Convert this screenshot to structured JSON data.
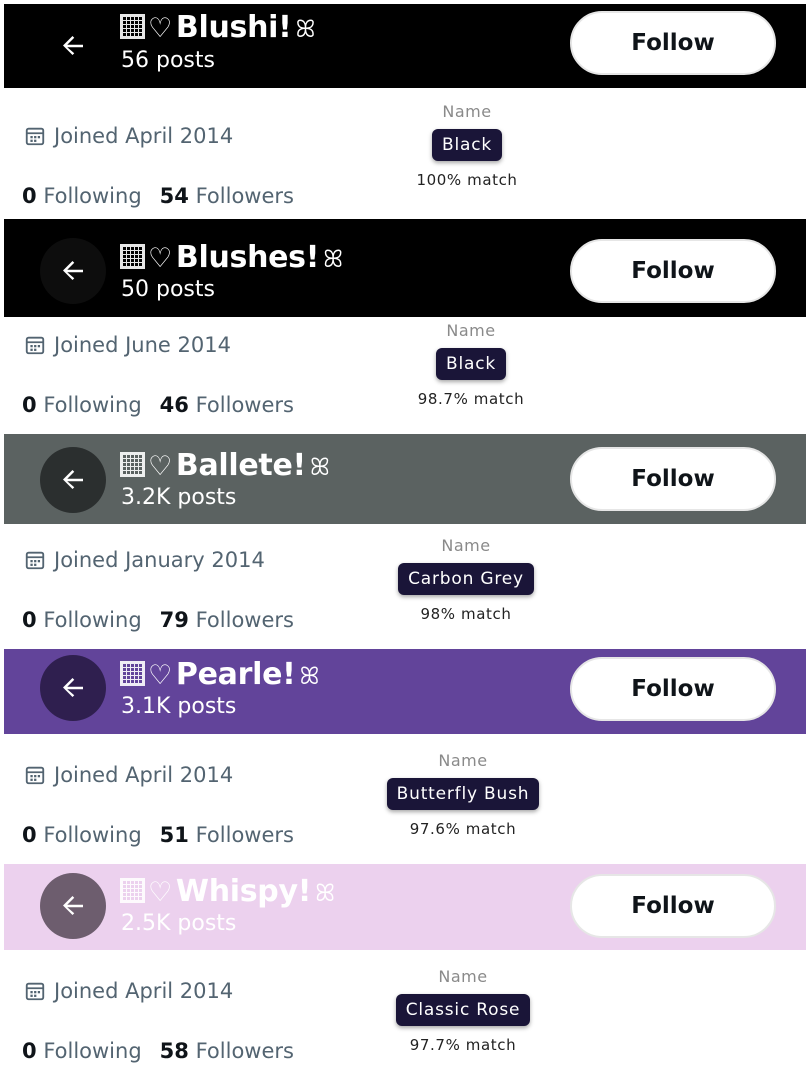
{
  "profiles": [
    {
      "name": "Blushi!",
      "posts": "56 posts",
      "follow_label": "Follow",
      "joined": "Joined April 2014",
      "following_count": "0",
      "following_label": "Following",
      "followers_count": "54",
      "followers_label": "Followers",
      "color_card": {
        "label": "Name",
        "color_name": "Black",
        "match": "100% match"
      },
      "header_bg": "#000000",
      "header_text": "#ffffff"
    },
    {
      "name": "Blushes!",
      "posts": "50 posts",
      "follow_label": "Follow",
      "joined": "Joined June 2014",
      "following_count": "0",
      "following_label": "Following",
      "followers_count": "46",
      "followers_label": "Followers",
      "color_card": {
        "label": "Name",
        "color_name": "Black",
        "match": "98.7% match"
      },
      "header_bg": "#000000",
      "header_text": "#ffffff"
    },
    {
      "name": "Ballete!",
      "posts": "3.2K posts",
      "follow_label": "Follow",
      "joined": "Joined January 2014",
      "following_count": "0",
      "following_label": "Following",
      "followers_count": "79",
      "followers_label": "Followers",
      "color_card": {
        "label": "Name",
        "color_name": "Carbon Grey",
        "match": "98% match"
      },
      "header_bg": "#5b6261",
      "header_text": "#ffffff"
    },
    {
      "name": "Pearle!",
      "posts": "3.1K posts",
      "follow_label": "Follow",
      "joined": "Joined April 2014",
      "following_count": "0",
      "following_label": "Following",
      "followers_count": "51",
      "followers_label": "Followers",
      "color_card": {
        "label": "Name",
        "color_name": "Butterfly Bush",
        "match": "97.6% match"
      },
      "header_bg": "#62449a",
      "header_text": "#ffffff"
    },
    {
      "name": "Whispy!",
      "posts": "2.5K posts",
      "follow_label": "Follow",
      "joined": "Joined April 2014",
      "following_count": "0",
      "following_label": "Following",
      "followers_count": "58",
      "followers_label": "Followers",
      "color_card": {
        "label": "Name",
        "color_name": "Classic Rose",
        "match": "97.7% match"
      },
      "header_bg": "#ecd1ee",
      "header_text": "#ffffff"
    }
  ],
  "icons": {
    "back": "back-arrow-icon",
    "calendar": "calendar-icon",
    "grid": "grid-square-icon",
    "heart": "heart-outline-icon",
    "bow": "ribbon-bow-icon"
  }
}
